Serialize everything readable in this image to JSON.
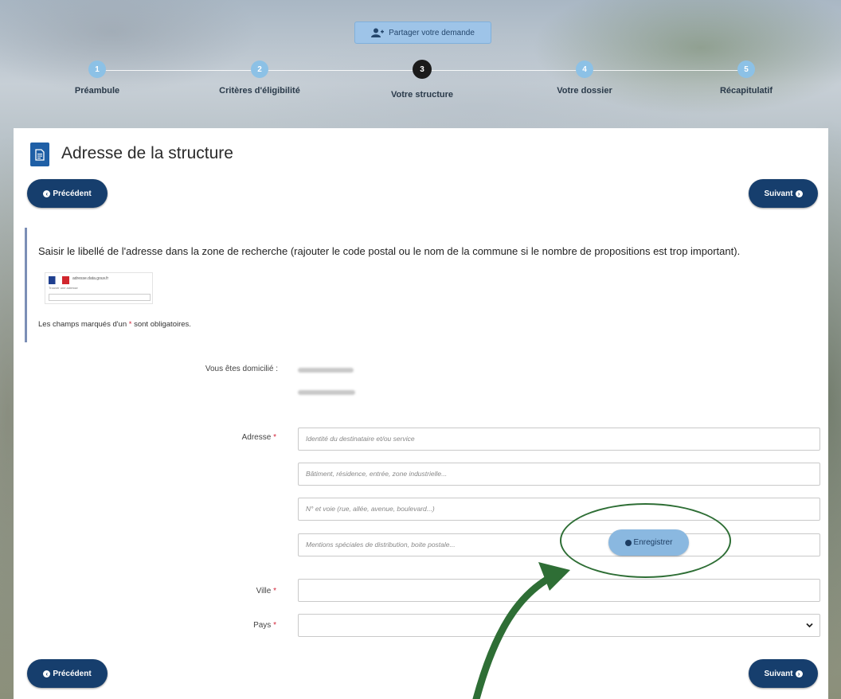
{
  "share_button": {
    "label": "Partager votre demande",
    "icon": "user-plus-icon"
  },
  "steps": [
    {
      "number": "1",
      "label": "Préambule",
      "state": "done"
    },
    {
      "number": "2",
      "label": "Critères d'éligibilité",
      "state": "done"
    },
    {
      "number": "3",
      "label": "Votre structure",
      "state": "active"
    },
    {
      "number": "4",
      "label": "Votre dossier",
      "state": "pending"
    },
    {
      "number": "5",
      "label": "Récapitulatif",
      "state": "pending"
    }
  ],
  "page": {
    "title": "Adresse de la structure",
    "title_icon": "document-icon"
  },
  "nav": {
    "previous_label": "Précédent",
    "next_label": "Suivant",
    "save_label": "Enregistrer"
  },
  "info": {
    "instruction": "Saisir le libellé de l'adresse dans la zone de recherche (rajouter le code postal ou le nom de la commune si le nombre de propositions est trop important).",
    "thumbnail_brand": "adresse.data.gouv.fr",
    "thumbnail_sub": "Trouver une adresse",
    "required_prefix": "Les champs marqués d'un",
    "required_star": "*",
    "required_suffix": "sont obligatoires."
  },
  "form": {
    "domicile_label": "Vous êtes domicilié :",
    "address_label": "Adresse",
    "address_placeholders": [
      "Identité du destinataire et/ou service",
      "Bâtiment, résidence, entrée, zone industrielle...",
      "N° et voie (rue, allée, avenue, boulevard...)",
      "Mentions spéciales de distribution, boite postale..."
    ],
    "city_label": "Ville",
    "city_value": "",
    "country_label": "Pays",
    "country_value": "",
    "required_mark": "*"
  },
  "colors": {
    "primary_dark": "#163e6d",
    "step_done": "#8cc1e6",
    "step_active": "#1b1b1b",
    "required": "#d3253a",
    "annotation_green": "#2e6e35",
    "save_button": "#8ab8e0"
  }
}
